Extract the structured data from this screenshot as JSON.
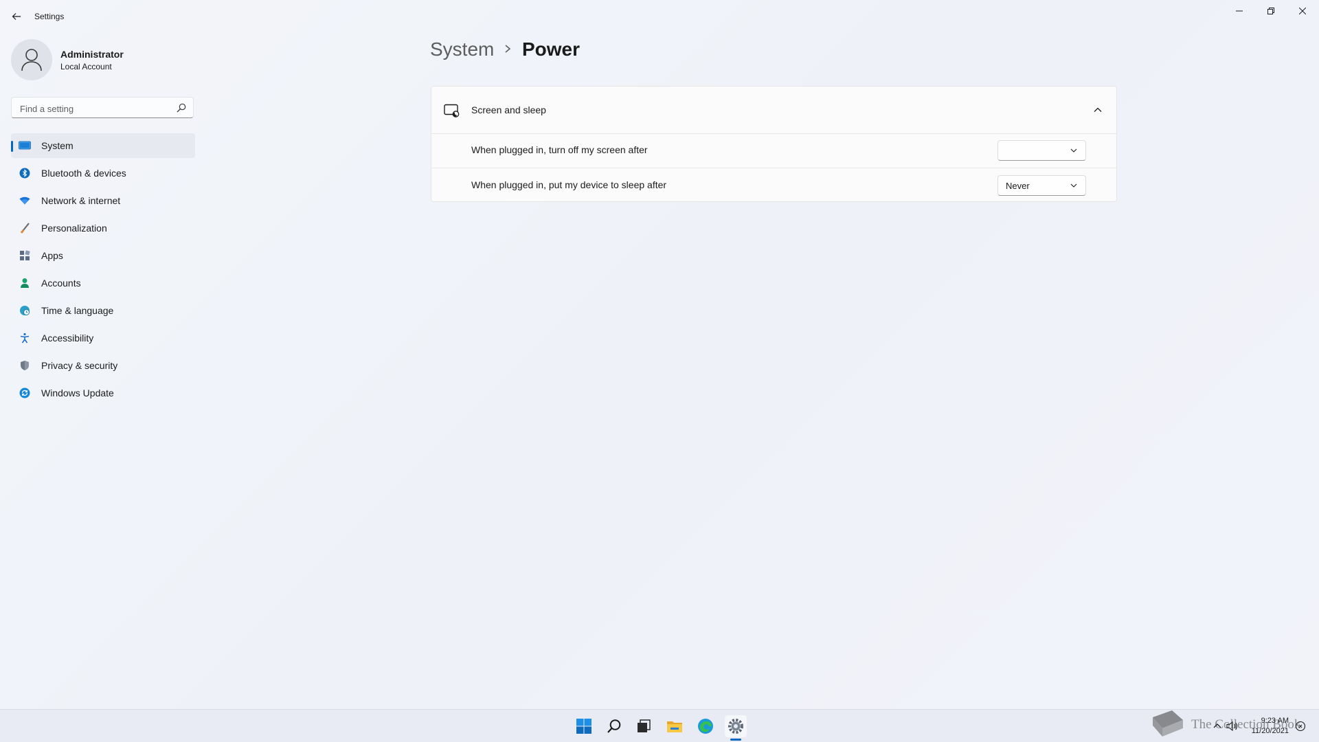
{
  "window": {
    "title": "Settings",
    "controls": [
      "minimize-icon",
      "restore-icon",
      "close-icon"
    ]
  },
  "profile": {
    "name": "Administrator",
    "account_type": "Local Account"
  },
  "search": {
    "placeholder": "Find a setting"
  },
  "sidebar": {
    "items": [
      {
        "label": "System",
        "icon": "system-display-icon",
        "active": true
      },
      {
        "label": "Bluetooth & devices",
        "icon": "bluetooth-icon",
        "active": false
      },
      {
        "label": "Network & internet",
        "icon": "wifi-icon",
        "active": false
      },
      {
        "label": "Personalization",
        "icon": "brush-icon",
        "active": false
      },
      {
        "label": "Apps",
        "icon": "apps-icon",
        "active": false
      },
      {
        "label": "Accounts",
        "icon": "accounts-icon",
        "active": false
      },
      {
        "label": "Time & language",
        "icon": "globe-clock-icon",
        "active": false
      },
      {
        "label": "Accessibility",
        "icon": "accessibility-icon",
        "active": false
      },
      {
        "label": "Privacy & security",
        "icon": "shield-icon",
        "active": false
      },
      {
        "label": "Windows Update",
        "icon": "update-icon",
        "active": false
      }
    ]
  },
  "breadcrumb": {
    "parent": "System",
    "current": "Power"
  },
  "screen_sleep": {
    "title": "Screen and sleep",
    "expanded": true,
    "rows": [
      {
        "label": "When plugged in, turn off my screen after",
        "value": ""
      },
      {
        "label": "When plugged in, put my device to sleep after",
        "value": "Never"
      }
    ]
  },
  "taskbar": {
    "apps": [
      "start-icon",
      "search-icon",
      "task-view-icon",
      "file-explorer-icon",
      "edge-icon",
      "settings-icon"
    ],
    "active_app": "settings-icon",
    "time": "9:23 AM",
    "date": "11/20/2021"
  },
  "watermark": {
    "text": "The Collection Book"
  },
  "colors": {
    "accent": "#0067c0",
    "background": "#f3f5fa",
    "card": "#fbfbfc"
  }
}
